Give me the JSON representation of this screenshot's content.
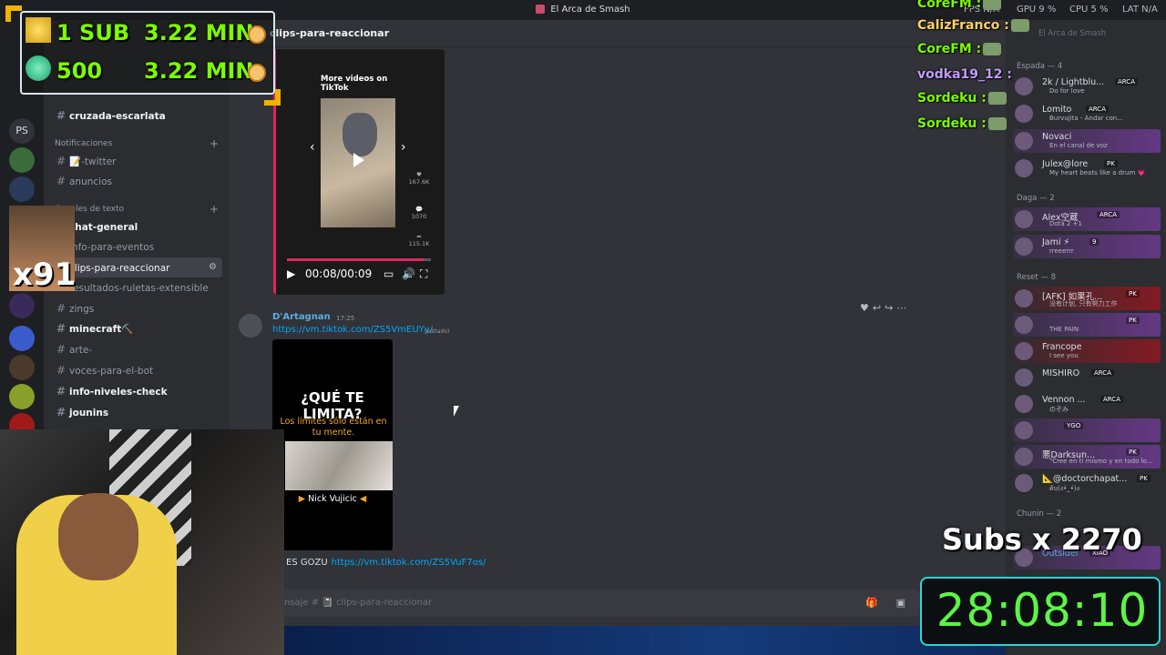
{
  "window": {
    "title": "El Arca de Smash"
  },
  "stream_stats": [
    "FPS N/A",
    "GPU 9 %",
    "CPU 5 %",
    "LAT N/A"
  ],
  "servers": [
    "PS"
  ],
  "channels": [
    {
      "name": "cruzada-escarlata",
      "bold": true
    },
    {
      "category": "Notificaciones"
    },
    {
      "name": "📝-twitter"
    },
    {
      "name": "anuncios"
    },
    {
      "category": "Canales de texto"
    },
    {
      "name": "chat-general",
      "bold": true
    },
    {
      "name": "info-para-eventos"
    },
    {
      "name": "clips-para-reaccionar",
      "active": true
    },
    {
      "name": "resultados-ruletas-extensible"
    },
    {
      "name": "zings"
    },
    {
      "name": "minecraft⛏️",
      "bold": true
    },
    {
      "name": "arte-"
    },
    {
      "name": "voces-para-el-bot"
    },
    {
      "name": "info-niveles-check",
      "bold": true
    },
    {
      "name": "jounins",
      "bold": true
    }
  ],
  "chat": {
    "header": "clips-para-reaccionar",
    "tiktok_embed": {
      "promo": "More videos on TikTok",
      "likes": "167.6K",
      "comments": "1070",
      "shares": "115.1K",
      "time": "00:08/00:09"
    },
    "message": {
      "author": "D'Artagnan",
      "time": "17:25",
      "link": "https://vm.tiktok.com/ZS5VmEUYy/",
      "edited": "(editado)"
    },
    "embed2": {
      "headline": "¿QUÉ TE LIMITA?",
      "subtitle": "Los límites sólo están en tu mente.",
      "name": "Nick Vujicic"
    },
    "message2": {
      "text": "ES GOZU",
      "link": "https://vm.tiktok.com/ZS5VuF7os/"
    },
    "composer": "nsaje # 📓 clips-para-reaccionar"
  },
  "members": {
    "search": "El Arca de Smash",
    "groups": [
      {
        "title": "Espada — 4",
        "items": [
          {
            "name": "2k / Lightblu...",
            "tag": "ARCA",
            "status": "Do for love"
          },
          {
            "name": "Lomito",
            "tag": "ARCA",
            "status": "Burvujita - Andar con..."
          },
          {
            "name": "Novaci",
            "tag": "",
            "status": "En el canal de voz"
          },
          {
            "name": "Julex@lore",
            "tag": "PK",
            "status": "My heart beats like a drum 💗"
          }
        ]
      },
      {
        "title": "Daga — 2",
        "items": [
          {
            "name": "Alex空蔵",
            "tag": "ARCA",
            "status": "Dota 2 +1"
          },
          {
            "name": "Jami ⚡",
            "tag": "9",
            "status": "rreeerrr"
          }
        ]
      },
      {
        "title": "Reset — 8",
        "items": [
          {
            "name": "[AFK] 如果孔...",
            "tag": "PK",
            "status": "没有计划, 只有努力工作"
          },
          {
            "name": "",
            "tag": "PK",
            "status": "THE PAIN"
          },
          {
            "name": "Francope",
            "tag": "",
            "status": "I see you"
          },
          {
            "name": "MISHIRO",
            "tag": "ARCA",
            "status": ""
          },
          {
            "name": "Vennon ...",
            "tag": "ARCA",
            "status": "のぞみ"
          },
          {
            "name": "",
            "tag": "YGO",
            "status": ""
          },
          {
            "name": "悪Darksun...",
            "tag": "PK",
            "status": "\"Cree en ti mismo y en todo lo..."
          },
          {
            "name": "📐@doctorchapat...",
            "tag": "PK",
            "status": "ด้บ(ง•̀_•́)ง"
          }
        ]
      },
      {
        "title": "Chunin — 2",
        "items": [
          {
            "name": "Outsider",
            "tag": "XIAO",
            "status": ""
          }
        ]
      }
    ]
  },
  "overlay": {
    "sub_rows": [
      {
        "count": "1 SUB",
        "time": "3.22 MIN"
      },
      {
        "count": "500",
        "time": "3.22 MIN"
      }
    ],
    "multiplier": "x91",
    "events": [
      {
        "name": "CoreFM :",
        "color": "#7CFC00"
      },
      {
        "name": "CalizFranco :",
        "color": "#ffd166"
      },
      {
        "name": "CoreFM :",
        "color": "#7CFC00"
      },
      {
        "name": "vodka19_12 :",
        "color": "#c39bff"
      },
      {
        "name": "Sordeku :",
        "color": "#7CFC00"
      },
      {
        "name": "Sordeku :",
        "color": "#7CFC00"
      }
    ],
    "subs_label": "Subs x 2270",
    "timer": "28:08:10"
  }
}
